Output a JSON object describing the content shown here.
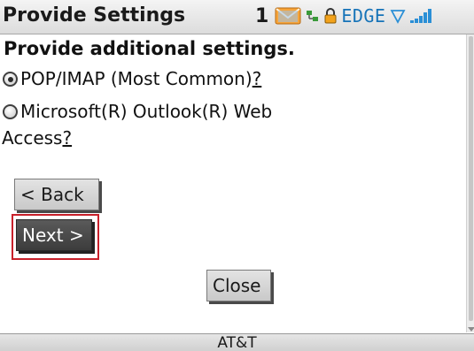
{
  "titlebar": {
    "title": "Provide Settings",
    "message_count": "1",
    "network": "EDGE",
    "icons": [
      "envelope-icon",
      "data-transfer-icon",
      "lock-icon",
      "wifi-icon",
      "signal-bars-icon"
    ]
  },
  "form": {
    "heading": "Provide additional settings.",
    "options": [
      {
        "label": "POP/IMAP (Most Common)",
        "help": "?",
        "selected": true
      },
      {
        "label_line1": "Microsoft(R) Outlook(R) Web",
        "label_line2": "Access",
        "help": "?",
        "selected": false
      }
    ]
  },
  "buttons": {
    "back": "< Back",
    "next": "Next >",
    "close": "Close"
  },
  "footer": {
    "carrier": "AT&T"
  },
  "colors": {
    "focus_outline": "#c8202a",
    "network_label": "#1673b8",
    "signal": "#2a8fd6"
  }
}
